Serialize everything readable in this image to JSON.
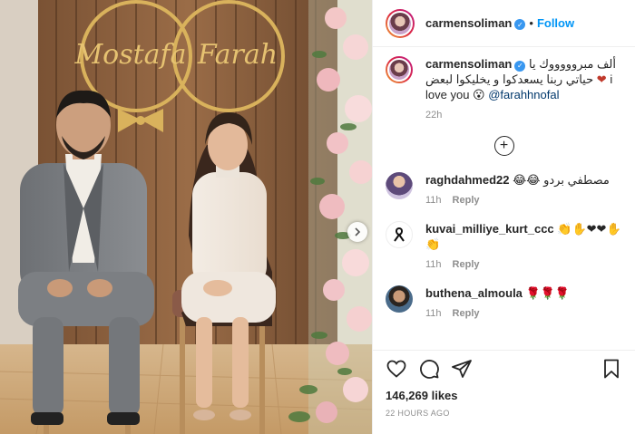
{
  "post": {
    "author": "carmensoliman",
    "follow_label": "Follow",
    "separator": "•",
    "verified_glyph": "✓",
    "caption": {
      "line1": "ألف مبروووووك يا",
      "line2": "حياتي ربنا يسعدكوا و يخليكوا لبعض",
      "line2_prefix": "i",
      "heart": "❤",
      "line3": "love you",
      "emoji": "😮",
      "mention": "@farahhnofal",
      "time": "22h"
    },
    "load_more_glyph": "+",
    "comments": [
      {
        "user": "raghdahmed22",
        "text": "مصطفي بردو 😂😂",
        "time": "11h",
        "reply": "Reply"
      },
      {
        "user": "kuvai_milliye_kurt_ccc",
        "text": "👏✋❤❤✋👏",
        "time": "11h",
        "reply": "Reply"
      },
      {
        "user": "buthena_almoula",
        "text": "🌹🌹🌹",
        "time": "11h",
        "reply": "Reply"
      }
    ],
    "likes": "146,269 likes",
    "posted": "22 HOURS AGO",
    "photo_sign": {
      "left": "Mostafa",
      "right": "Farah"
    }
  },
  "colors": {
    "accent": "#0095f6",
    "verified": "#3897f0",
    "muted": "#8e8e8e"
  },
  "icons": [
    "verified-badge-icon",
    "heart-icon",
    "comment-icon",
    "share-icon",
    "bookmark-icon",
    "carousel-next-icon",
    "load-more-comments-icon"
  ]
}
